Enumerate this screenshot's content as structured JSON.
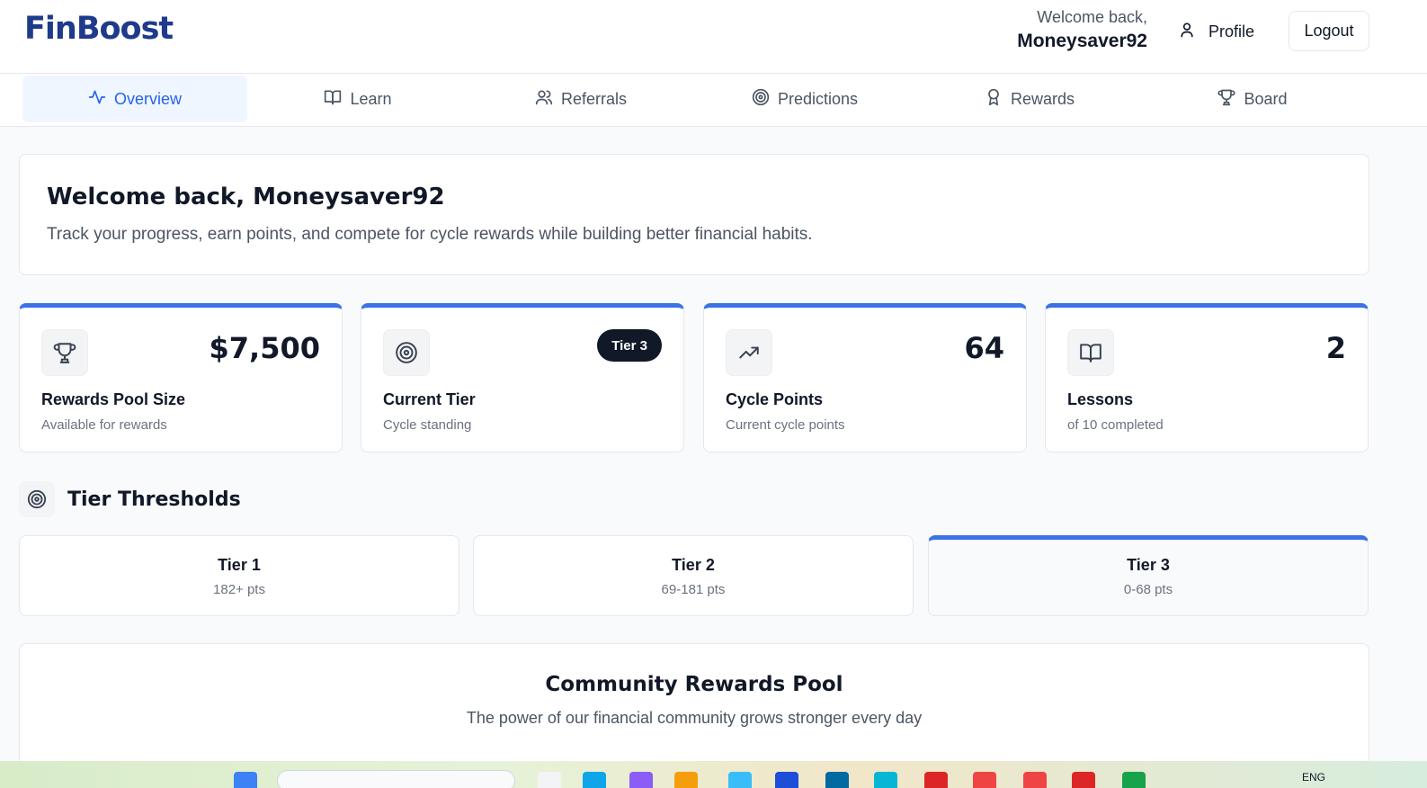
{
  "header": {
    "logo": "FinBoost",
    "welcome_label": "Welcome back,",
    "username": "Moneysaver92",
    "profile_label": "Profile",
    "logout_label": "Logout"
  },
  "nav": {
    "active_index": 0,
    "tabs": [
      {
        "label": "Overview",
        "icon": "activity-icon"
      },
      {
        "label": "Learn",
        "icon": "book-open-icon"
      },
      {
        "label": "Referrals",
        "icon": "users-icon"
      },
      {
        "label": "Predictions",
        "icon": "target-icon"
      },
      {
        "label": "Rewards",
        "icon": "award-icon"
      },
      {
        "label": "Board",
        "icon": "trophy-icon"
      }
    ]
  },
  "welcome_card": {
    "title": "Welcome back, Moneysaver92",
    "subtitle": "Track your progress, earn points, and compete for cycle rewards while building better financial habits."
  },
  "stats": [
    {
      "icon": "trophy-icon",
      "value": "$7,500",
      "title": "Rewards Pool Size",
      "subtitle": "Available for rewards"
    },
    {
      "icon": "target-icon",
      "badge": "Tier 3",
      "title": "Current Tier",
      "subtitle": "Cycle standing"
    },
    {
      "icon": "trending-up-icon",
      "value": "64",
      "title": "Cycle Points",
      "subtitle": "Current cycle points"
    },
    {
      "icon": "book-open-icon",
      "value": "2",
      "title": "Lessons",
      "subtitle": "of 10 completed"
    }
  ],
  "tier_section": {
    "title": "Tier Thresholds",
    "icon": "target-icon",
    "tiers": [
      {
        "name": "Tier 1",
        "range": "182+ pts",
        "current": false
      },
      {
        "name": "Tier 2",
        "range": "69-181 pts",
        "current": false
      },
      {
        "name": "Tier 3",
        "range": "0-68 pts",
        "current": true
      }
    ]
  },
  "pool_card": {
    "title": "Community Rewards Pool",
    "subtitle": "The power of our financial community grows stronger every day"
  },
  "taskbar": {
    "language": "ENG"
  },
  "colors": {
    "accent": "#2563eb",
    "card_top_bar": "#3b73e4",
    "logo": "#1e3a8a",
    "badge_bg": "#111827"
  }
}
